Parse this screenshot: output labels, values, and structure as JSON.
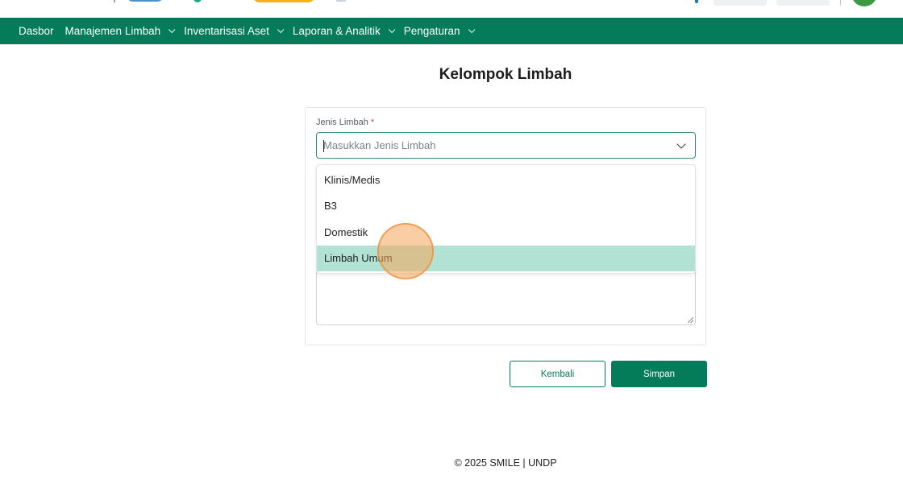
{
  "header": {
    "logos": [
      "partner-logo-1",
      "partner-logo-2",
      "partner-logo-3",
      "partner-logo-4"
    ]
  },
  "nav": {
    "items": [
      {
        "label": "Dasbor",
        "has_dropdown": false
      },
      {
        "label": "Manajemen Limbah",
        "has_dropdown": true
      },
      {
        "label": "Inventarisasi Aset",
        "has_dropdown": true
      },
      {
        "label": "Laporan & Analitik",
        "has_dropdown": true
      },
      {
        "label": "Pengaturan",
        "has_dropdown": true
      }
    ],
    "background": "#057c59"
  },
  "page": {
    "title": "Kelompok Limbah"
  },
  "form": {
    "jenis_limbah": {
      "label": "Jenis Limbah",
      "required_mark": "*",
      "placeholder": "Masukkan Jenis Limbah",
      "options": [
        "Klinis/Medis",
        "B3",
        "Domestik",
        "Limbah Umum"
      ],
      "highlighted_option": "Limbah Umum"
    }
  },
  "actions": {
    "back_label": "Kembali",
    "save_label": "Simpan"
  },
  "footer": {
    "text": "© 2025 SMILE | UNDP"
  },
  "colors": {
    "primary": "#057c59",
    "option_highlight": "#b1e2d3",
    "required": "#e0324a"
  }
}
